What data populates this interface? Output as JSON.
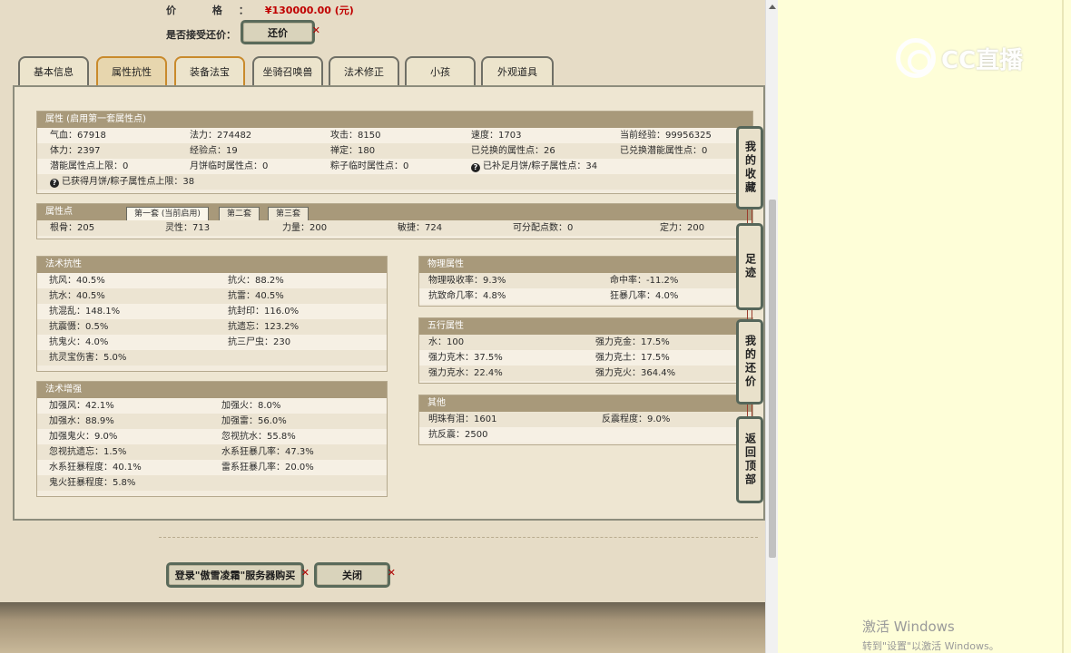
{
  "listing": {
    "price_label": "价 格：",
    "price_value": "¥130000.00 (元)",
    "bargain_label": "是否接受还价：",
    "bargain_button": "还价"
  },
  "tabs": [
    {
      "label": "基本信息"
    },
    {
      "label": "属性抗性"
    },
    {
      "label": "装备法宝"
    },
    {
      "label": "坐骑召唤兽"
    },
    {
      "label": "法术修正"
    },
    {
      "label": "小孩"
    },
    {
      "label": "外观道具"
    }
  ],
  "attributes": {
    "title": "属性 (启用第一套属性点)",
    "rows": [
      [
        "气血：67918",
        "法力：274482",
        "攻击：8150",
        "速度：1703",
        "当前经验：99956325"
      ],
      [
        "体力：2397",
        "经验点：19",
        "禅定：180",
        "已兑换的属性点：26",
        "已兑换潜能属性点：0"
      ],
      [
        "潜能属性点上限：0",
        "月饼临时属性点：0",
        "粽子临时属性点：0",
        "已补足月饼/粽子属性点：34",
        ""
      ],
      [
        "已获得月饼/粽子属性点上限：38",
        "",
        "",
        "",
        ""
      ]
    ]
  },
  "attr_points": {
    "title": "属性点",
    "subtabs": [
      "第一套 (当前启用)",
      "第二套",
      "第三套"
    ],
    "values": [
      "根骨：205",
      "灵性：713",
      "力量：200",
      "敏捷：724",
      "可分配点数：0",
      "定力：200"
    ]
  },
  "magic_resist": {
    "title": "法术抗性",
    "rows": [
      [
        "抗风：40.5%",
        "抗火：88.2%"
      ],
      [
        "抗水：40.5%",
        "抗雷：40.5%"
      ],
      [
        "抗混乱：148.1%",
        "抗封印：116.0%"
      ],
      [
        "抗震慑：0.5%",
        "抗遗忘：123.2%"
      ],
      [
        "抗鬼火：4.0%",
        "抗三尸虫：230"
      ],
      [
        "抗灵宝伤害：5.0%",
        ""
      ]
    ]
  },
  "magic_boost": {
    "title": "法术增强",
    "rows": [
      [
        "加强风：42.1%",
        "加强火：8.0%"
      ],
      [
        "加强水：88.9%",
        "加强雷：56.0%"
      ],
      [
        "加强鬼火：9.0%",
        "忽视抗水：55.8%"
      ],
      [
        "忽视抗遗忘：1.5%",
        "水系狂暴几率：47.3%"
      ],
      [
        "水系狂暴程度：40.1%",
        "雷系狂暴几率：20.0%"
      ],
      [
        "鬼火狂暴程度：5.8%",
        ""
      ]
    ]
  },
  "physical": {
    "title": "物理属性",
    "rows": [
      [
        "物理吸收率：9.3%",
        "命中率：-11.2%"
      ],
      [
        "抗致命几率：4.8%",
        "狂暴几率：4.0%"
      ]
    ]
  },
  "five_elements": {
    "title": "五行属性",
    "rows": [
      [
        "水：100",
        "强力克金：17.5%"
      ],
      [
        "强力克木：37.5%",
        "强力克土：17.5%"
      ],
      [
        "强力克水：22.4%",
        "强力克火：364.4%"
      ]
    ]
  },
  "other": {
    "title": "其他",
    "rows": [
      [
        "明珠有泪：1601",
        "反震程度：9.0%"
      ],
      [
        "抗反震：2500",
        ""
      ]
    ]
  },
  "side_buttons": [
    {
      "label": "我的收藏"
    },
    {
      "label": "足迹"
    },
    {
      "label": "我的还价"
    },
    {
      "label": "返回顶部"
    }
  ],
  "footer": {
    "login_button": "登录\"傲雪凌霜\"服务器购买",
    "close_button": "关闭"
  },
  "overlay": {
    "cc_logo": "CC直播",
    "activate_line1": "激活 Windows",
    "activate_line2": "转到\"设置\"以激活 Windows。"
  }
}
